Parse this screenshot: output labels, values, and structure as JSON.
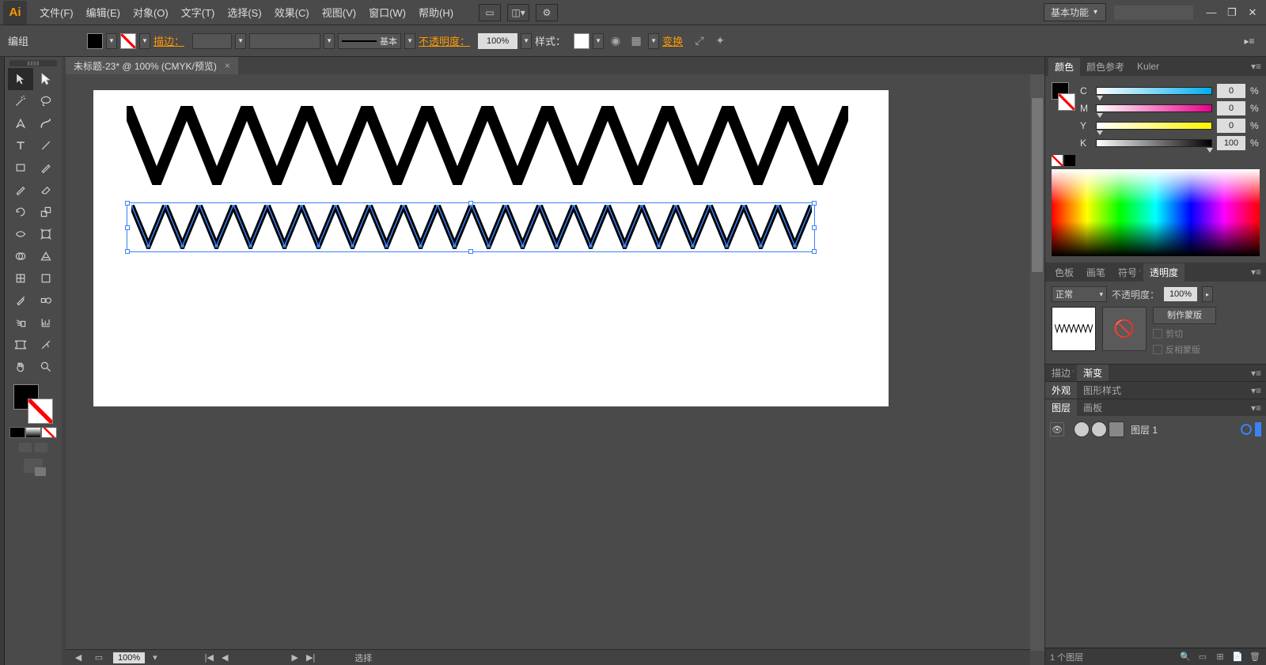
{
  "app": {
    "icon_text": "Ai"
  },
  "menu": {
    "file": "文件(F)",
    "edit": "编辑(E)",
    "object": "对象(O)",
    "type": "文字(T)",
    "select": "选择(S)",
    "effect": "效果(C)",
    "view": "视图(V)",
    "window": "窗口(W)",
    "help": "帮助(H)"
  },
  "workspace": {
    "label": "基本功能"
  },
  "control": {
    "context": "编组",
    "stroke_label": "描边：",
    "brush_label": "基本",
    "opacity_label": "不透明度：",
    "opacity_value": "100%",
    "style_label": "样式：",
    "transform_label": "变换"
  },
  "document": {
    "tab_title": "未标题-23* @ 100% (CMYK/预览)",
    "zoom": "100%",
    "status_tool": "选择"
  },
  "panels": {
    "color_tab": "颜色",
    "color_guide_tab": "颜色参考",
    "kuler_tab": "Kuler",
    "swatches_tab": "色板",
    "brushes_tab": "画笔",
    "symbols_tab": "符号",
    "transparency_tab": "透明度",
    "stroke_tab2": "描边",
    "gradient_tab": "渐变",
    "appearance_tab": "外观",
    "graphic_styles_tab": "图形样式",
    "layers_tab": "图层",
    "artboards_tab": "画板"
  },
  "cmyk": {
    "c_label": "C",
    "c_value": "0",
    "m_label": "M",
    "m_value": "0",
    "y_label": "Y",
    "y_value": "0",
    "k_label": "K",
    "k_value": "100",
    "pct": "%"
  },
  "transparency": {
    "blend_mode": "正常",
    "opacity_label": "不透明度：",
    "opacity_value": "100%",
    "make_mask": "制作蒙版",
    "clip": "剪切",
    "invert": "反相蒙版"
  },
  "layers": {
    "layer1_name": "图层 1",
    "footer_count": "1 个图层"
  }
}
